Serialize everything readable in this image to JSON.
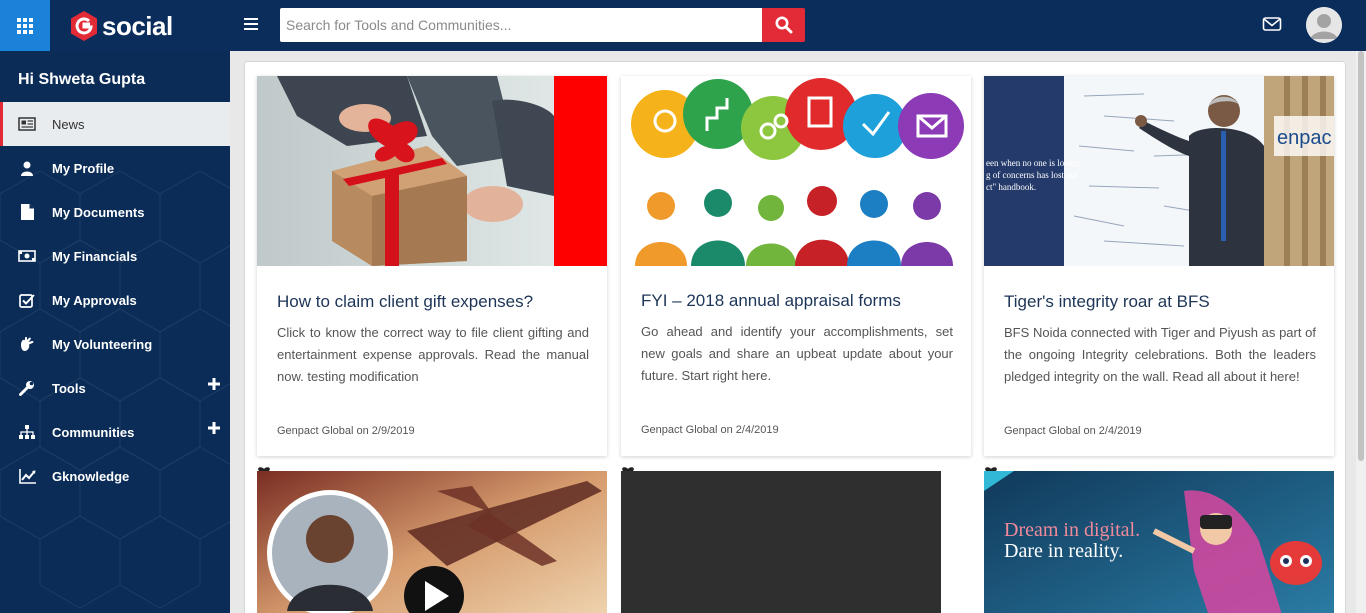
{
  "header": {
    "brand": "social",
    "search_placeholder": "Search for Tools and Communities..."
  },
  "sidebar": {
    "greeting": "Hi Shweta Gupta",
    "items": [
      {
        "label": "News",
        "icon": "newspaper-icon"
      },
      {
        "label": "My Profile",
        "icon": "user-icon"
      },
      {
        "label": "My Documents",
        "icon": "document-icon"
      },
      {
        "label": "My Financials",
        "icon": "money-icon"
      },
      {
        "label": "My Approvals",
        "icon": "checkbox-icon"
      },
      {
        "label": "My Volunteering",
        "icon": "hand-icon"
      },
      {
        "label": "Tools",
        "icon": "wrench-icon"
      },
      {
        "label": "Communities",
        "icon": "sitemap-icon"
      },
      {
        "label": "Gknowledge",
        "icon": "chart-icon"
      }
    ]
  },
  "cards": [
    {
      "title": "How to claim client gift expenses?",
      "description": "Click to know the correct way to file client gifting and entertainment expense approvals. Read the manual now. testing modification",
      "meta": "Genpact Global on 2/9/2019"
    },
    {
      "title": "FYI – 2018 annual appraisal forms",
      "description": "Go ahead and identify your accomplishments, set new goals and share an upbeat update about your future. Start right here.",
      "meta": "Genpact Global on 2/4/2019"
    },
    {
      "title": "Tiger's integrity roar at BFS",
      "description": "BFS Noida connected with Tiger and Piyush as part of the ongoing Integrity celebrations. Both the leaders pledged integrity on the wall. Read all about it here!",
      "meta": "Genpact Global on 2/4/2019"
    }
  ],
  "banner": {
    "line1": "Dream in digital.",
    "line2": "Dare in reality."
  },
  "whiteboard_text": {
    "brand_fragment": "enpac",
    "line1": "een when no one is lookin",
    "line2": "g of concerns has lost out",
    "line3": "ct\" handbook."
  },
  "colors": {
    "topbar": "#0b2d5c",
    "sidebar": "#0a2c57",
    "accent_red": "#e32b37",
    "apps_blue": "#1a82d8"
  }
}
